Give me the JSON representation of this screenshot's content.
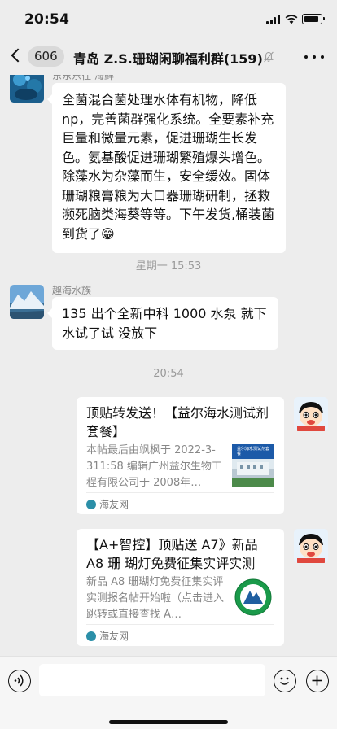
{
  "status_bar": {
    "time": "20:54"
  },
  "nav": {
    "unread_count": "606",
    "title": "青岛 Z.S.珊瑚闲聊福利群(159)"
  },
  "messages": [
    {
      "sender": "东东东往 海鲜",
      "text": "全菌混合菌处理水体有机物，降低np，完善菌群强化系统。全要素补充巨量和微量元素，促进珊瑚生长发色。氨基酸促进珊瑚繁殖爆头增色。除藻水为杂藻而生，安全缓效。固体珊瑚粮膏粮为大口器珊瑚研制，拯救濒死脑类海葵等等。下午发货,桶装菌到货了😁"
    },
    {
      "timestamp": "星期一 15:53"
    },
    {
      "sender": "趣海水族",
      "text": "135 出个全新中科 1000 水泵 就下水试了试 没放下"
    },
    {
      "timestamp": "20:54"
    }
  ],
  "cards": [
    {
      "title": "顶贴转发送！【益尔海水测试剂套餐】",
      "desc": "本帖最后由飒枫于 2022-3-311:58 编辑广州益尔生物工程有限公司于 2008年…",
      "thumb_caption": "益尔海水测试剂套餐",
      "source": "海友网"
    },
    {
      "title": "【A+智控】顶贴送 A7》新品A8 珊 瑚灯免费征集实评实测",
      "desc": "新品 A8 珊瑚灯免费征集实评实测报名帖开始啦（点击进入跳转或直接查找 A…",
      "thumb_caption": "",
      "source": "海友网"
    }
  ],
  "input": {
    "placeholder": ""
  },
  "colors": {
    "background": "#ededed",
    "bubble": "#ffffff",
    "brand_dot": "#2b8fa8"
  }
}
